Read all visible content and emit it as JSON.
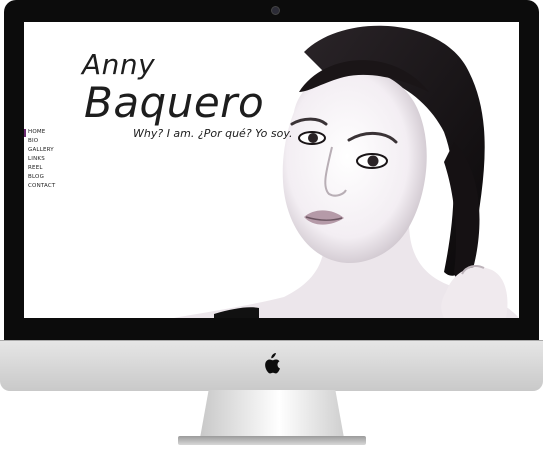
{
  "site": {
    "name_first": "Anny",
    "name_last": "Baquero",
    "tagline": "Why? I am. ¿Por qué? Yo soy."
  },
  "nav": {
    "active_color": "#6a2b6f",
    "items": [
      {
        "label": "HOME"
      },
      {
        "label": "BIO"
      },
      {
        "label": "GALLERY"
      },
      {
        "label": "LINKS"
      },
      {
        "label": "REEL"
      },
      {
        "label": "BLOG"
      },
      {
        "label": "CONTACT"
      }
    ]
  },
  "device": {
    "logo_icon": "apple-logo-icon"
  }
}
